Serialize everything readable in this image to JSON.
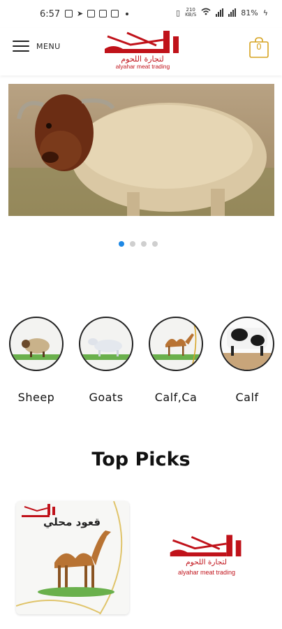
{
  "status_bar": {
    "time": "6:57",
    "battery": "81%",
    "net_speed_top": "210",
    "net_speed_bottom": "KB/S"
  },
  "header": {
    "menu_label": "MENU",
    "logo_arabic": "لتجارة اللحوم",
    "logo_sub": "alyahar meat trading",
    "cart_count": "0"
  },
  "carousel": {
    "slides": 4,
    "active_index": 0
  },
  "categories": [
    {
      "label": "Sheep",
      "icon": "sheep-icon"
    },
    {
      "label": "Goats",
      "icon": "goat-icon"
    },
    {
      "label": "Calf,Ca",
      "icon": "camel-icon"
    },
    {
      "label": "Calf",
      "icon": "calf-icon"
    }
  ],
  "top_picks": {
    "title": "Top Picks",
    "product_name": "قعود محلي",
    "brand_sub": "alyahar meat trading"
  },
  "colors": {
    "brand_red": "#c0121a",
    "cart_gold": "#d6a320",
    "dot_active": "#1e88e5"
  }
}
